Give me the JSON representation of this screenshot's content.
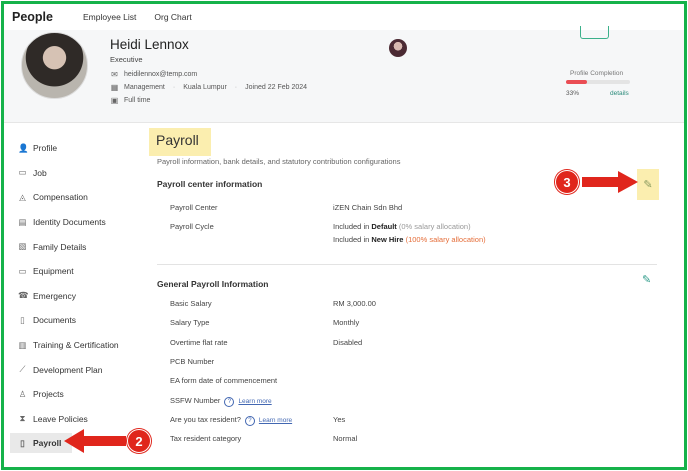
{
  "nav": {
    "brand": "People",
    "tabs": [
      "Employee List",
      "Org Chart"
    ]
  },
  "header": {
    "name": "Heidi Lennox",
    "position": "Executive",
    "email": "heidilennox@temp.com",
    "department": "Management",
    "location": "Kuala Lumpur",
    "joined": "Joined 22 Feb 2024",
    "employment": "Full time",
    "profile_completion": {
      "label": "Profile Completion",
      "percent_text": "33%",
      "value": 33,
      "details": "details"
    }
  },
  "sidebar": {
    "items": [
      {
        "label": "Profile",
        "icon": "person-icon"
      },
      {
        "label": "Job",
        "icon": "briefcase-icon"
      },
      {
        "label": "Compensation",
        "icon": "money-bag-icon"
      },
      {
        "label": "Identity Documents",
        "icon": "id-card-icon"
      },
      {
        "label": "Family Details",
        "icon": "family-icon"
      },
      {
        "label": "Equipment",
        "icon": "laptop-icon"
      },
      {
        "label": "Emergency",
        "icon": "phone-icon"
      },
      {
        "label": "Documents",
        "icon": "document-icon"
      },
      {
        "label": "Training & Certification",
        "icon": "certificate-icon"
      },
      {
        "label": "Development Plan",
        "icon": "chart-icon"
      },
      {
        "label": "Projects",
        "icon": "project-icon"
      },
      {
        "label": "Leave Policies",
        "icon": "hourglass-icon"
      },
      {
        "label": "Payroll",
        "icon": "payroll-icon",
        "active": true
      }
    ]
  },
  "annotations": {
    "step2": "2",
    "step3": "3"
  },
  "payroll": {
    "title": "Payroll",
    "subtitle": "Payroll information, bank details, and statutory contribution configurations",
    "center_section": {
      "title": "Payroll center information",
      "center_label": "Payroll Center",
      "center_value": "iZEN Chain Sdn Bhd",
      "cycle_label": "Payroll Cycle",
      "cycle_line1_prefix": "Included in",
      "cycle_line1_name": "Default",
      "cycle_line1_note": "(0% salary allocation)",
      "cycle_line2_prefix": "Included in",
      "cycle_line2_name": "New Hire",
      "cycle_line2_note": "(100% salary allocation)"
    },
    "general_section": {
      "title": "General Payroll Information",
      "rows": [
        {
          "label": "Basic Salary",
          "value": "RM 3,000.00"
        },
        {
          "label": "Salary Type",
          "value": "Monthly"
        },
        {
          "label": "Overtime flat rate",
          "value": "Disabled"
        },
        {
          "label": "PCB Number",
          "value": ""
        },
        {
          "label": "EA form date of commencement",
          "value": ""
        },
        {
          "label": "SSFW Number",
          "value": ""
        },
        {
          "label": "Are you tax resident?",
          "value": "Yes"
        },
        {
          "label": "Tax resident category",
          "value": "Normal"
        }
      ],
      "learn_more": "Learn more"
    }
  }
}
